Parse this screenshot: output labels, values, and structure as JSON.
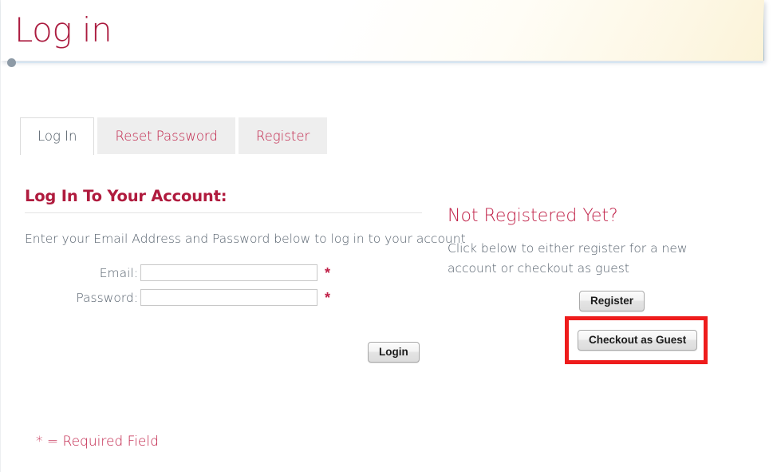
{
  "header": {
    "title": "Log in"
  },
  "tabs": [
    {
      "label": "Log In",
      "active": true
    },
    {
      "label": "Reset Password",
      "active": false
    },
    {
      "label": "Register",
      "active": false
    }
  ],
  "login_panel": {
    "heading": "Log In To Your Account:",
    "intro": "Enter your Email Address and Password below to log in to your account",
    "fields": [
      {
        "label": "Email:",
        "value": "",
        "placeholder": "",
        "required_marker": "*"
      },
      {
        "label": "Password:",
        "value": "",
        "placeholder": "",
        "required_marker": "*"
      }
    ],
    "submit_label": "Login"
  },
  "register_panel": {
    "heading": "Not Registered Yet?",
    "text": "Click below to either register for a new account or checkout as guest",
    "register_label": "Register",
    "guest_label": "Checkout as Guest"
  },
  "footer": {
    "required_note": "* = Required Field"
  },
  "colors": {
    "brand_crimson": "#b01b3e",
    "tab_link": "#c02148",
    "body_text": "#56616d",
    "highlight_red": "#ee1c1c",
    "rule_blue": "#d6e6f2",
    "dot_gray": "#8d9aa6"
  }
}
